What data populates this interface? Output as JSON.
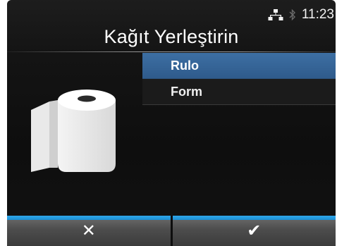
{
  "status": {
    "time": "11:23",
    "icons": [
      "network-icon",
      "bluetooth-icon"
    ]
  },
  "screen": {
    "title": "Kağıt Yerleştirin"
  },
  "menu": {
    "items": [
      {
        "label": "Rulo",
        "selected": true
      },
      {
        "label": "Form",
        "selected": false
      }
    ]
  },
  "footer": {
    "cancel_label": "✕",
    "confirm_label": "✔"
  },
  "colors": {
    "selection": "#3a6a9c",
    "footer_accent": "#2fa7ea",
    "background": "#121212"
  }
}
